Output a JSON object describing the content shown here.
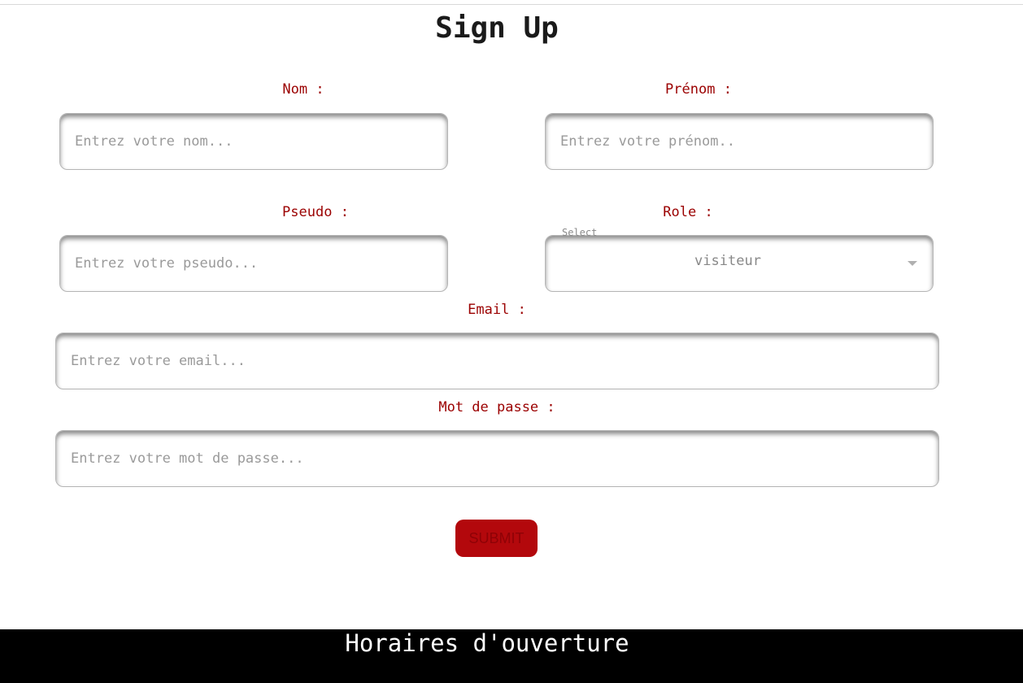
{
  "page": {
    "title": "Sign Up"
  },
  "form": {
    "nom": {
      "label": "Nom :",
      "placeholder": "Entrez votre nom...",
      "value": ""
    },
    "prenom": {
      "label": "Prénom :",
      "placeholder": "Entrez votre prénom..",
      "value": ""
    },
    "pseudo": {
      "label": "Pseudo :",
      "placeholder": "Entrez votre pseudo...",
      "value": ""
    },
    "role": {
      "label": "Role :",
      "floating_label": "Select",
      "selected": "visiteur"
    },
    "email": {
      "label": "Email :",
      "placeholder": "Entrez votre email...",
      "value": ""
    },
    "password": {
      "label": "Mot de passe :",
      "placeholder": "Entrez votre mot de passe...",
      "value": ""
    },
    "submit_label": "SUBMIT"
  },
  "footer": {
    "title": "Horaires d'ouverture"
  },
  "colors": {
    "label": "#9b0000",
    "button": "#b3080c",
    "footer_bg": "#000000"
  },
  "icons": {
    "role_dropdown": "caret-down-icon"
  }
}
